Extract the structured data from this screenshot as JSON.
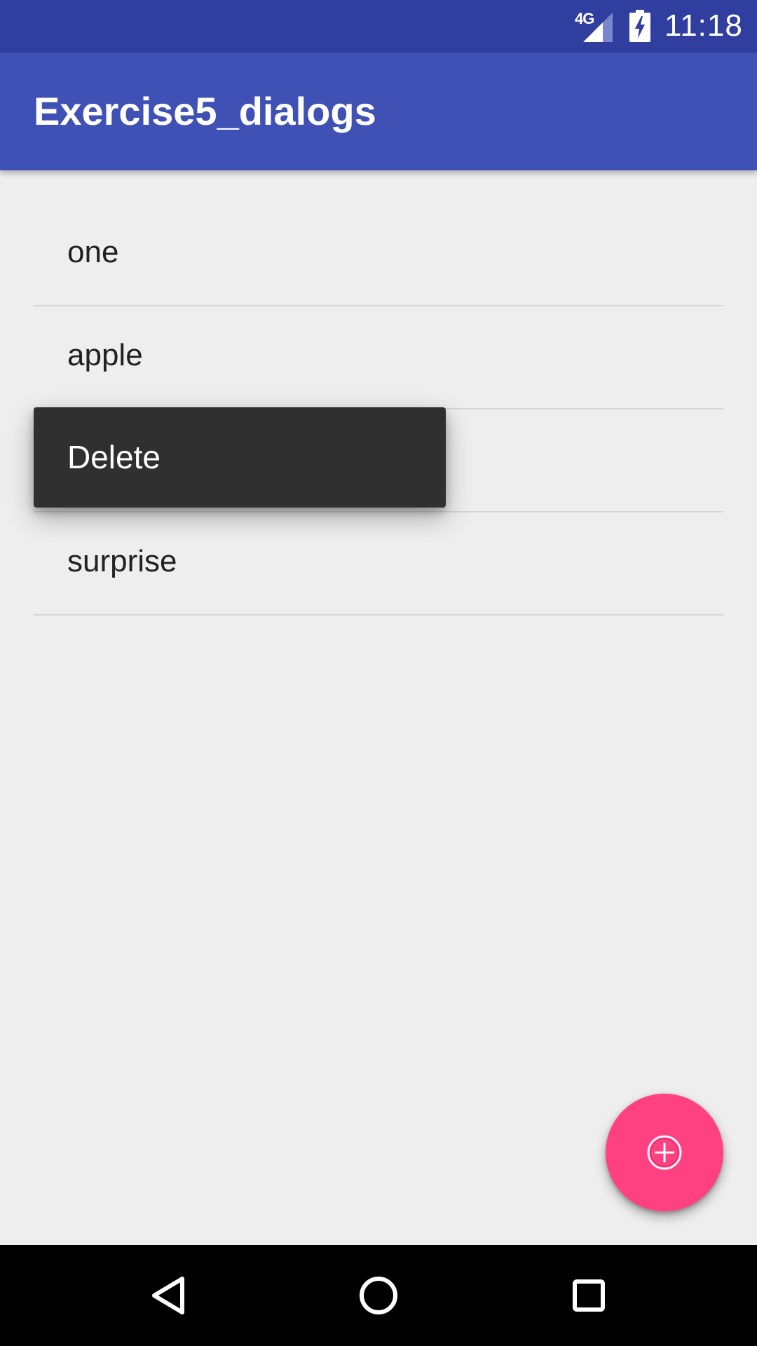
{
  "status_bar": {
    "network": "4G",
    "time": "11:18",
    "signal_icon": "signal-icon",
    "battery_icon": "battery-charging-icon"
  },
  "app_bar": {
    "title": "Exercise5_dialogs"
  },
  "list": {
    "items": [
      {
        "label": "one"
      },
      {
        "label": "apple"
      },
      {
        "label": ""
      },
      {
        "label": "surprise"
      }
    ]
  },
  "context_menu": {
    "items": [
      {
        "label": "Delete"
      }
    ]
  },
  "fab": {
    "icon": "add-circle-icon",
    "color": "#ff4081"
  },
  "nav_bar": {
    "back_icon": "back-icon",
    "home_icon": "home-icon",
    "recents_icon": "recents-icon"
  },
  "colors": {
    "primary_dark": "#303f9f",
    "primary": "#3f51b5",
    "accent": "#ff4081",
    "background": "#eeeeee"
  }
}
